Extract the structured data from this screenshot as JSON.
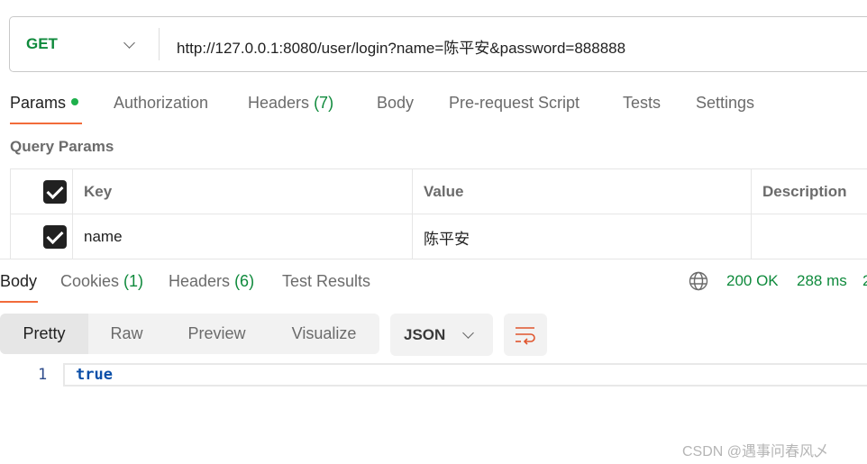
{
  "request": {
    "method": "GET",
    "url": "http://127.0.0.1:8080/user/login?name=陈平安&password=888888"
  },
  "request_tabs": [
    {
      "label": "Params",
      "active": true,
      "dot": true
    },
    {
      "label": "Authorization"
    },
    {
      "label": "Headers",
      "count": "(7)"
    },
    {
      "label": "Body"
    },
    {
      "label": "Pre-request Script"
    },
    {
      "label": "Tests"
    },
    {
      "label": "Settings"
    }
  ],
  "query_params": {
    "title": "Query Params",
    "columns": [
      "Key",
      "Value",
      "Description"
    ],
    "rows": [
      {
        "checked": true,
        "key": "name",
        "value": "陈平安",
        "description": ""
      }
    ]
  },
  "response_tabs": [
    {
      "label": "Body",
      "active": true
    },
    {
      "label": "Cookies",
      "count": "(1)"
    },
    {
      "label": "Headers",
      "count": "(6)"
    },
    {
      "label": "Test Results"
    }
  ],
  "status": {
    "code": "200 OK",
    "time": "288 ms",
    "size_partial": "2",
    "color": "#0f8a3c"
  },
  "view_modes": [
    "Pretty",
    "Raw",
    "Preview",
    "Visualize"
  ],
  "format": "JSON",
  "code": {
    "line": "1",
    "text": "true"
  },
  "watermark": "CSDN @遇事问春风乄",
  "colors": {
    "accent": "#f26b3a",
    "method": "#0f8a3c"
  }
}
